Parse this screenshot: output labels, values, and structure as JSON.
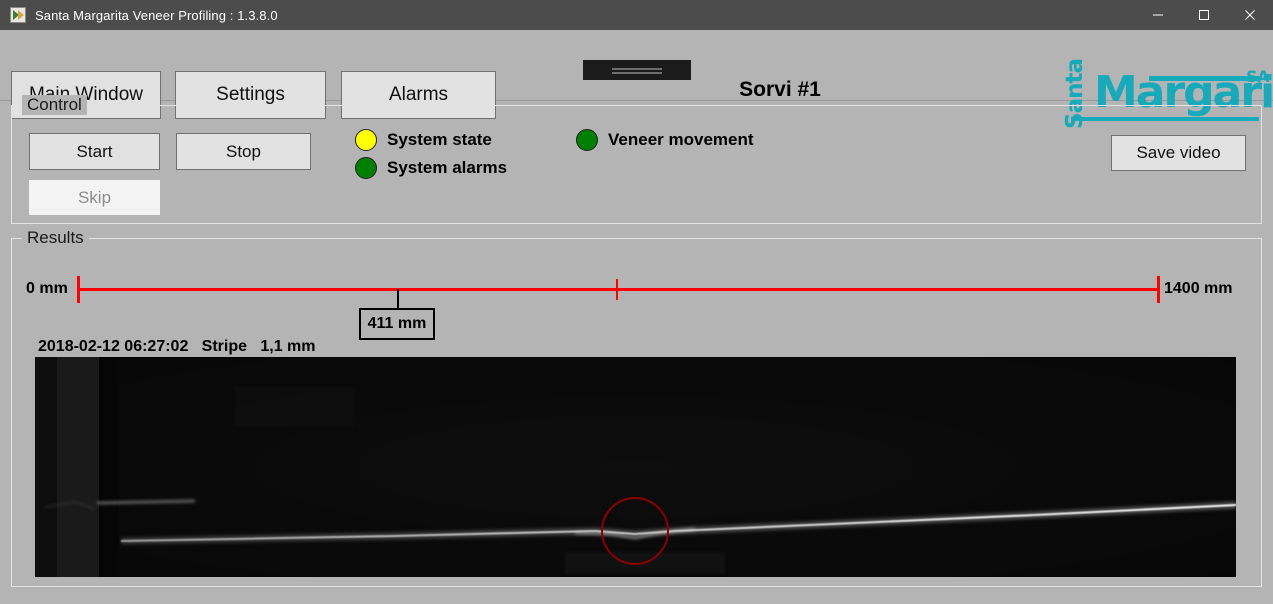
{
  "window": {
    "title": "Santa Margarita Veneer Profiling : 1.3.8.0",
    "icon": "app-icon",
    "minimize": "−",
    "maximize": "□",
    "close": "✕"
  },
  "header": {
    "nav": [
      {
        "label": "Main Window",
        "name": "main-window"
      },
      {
        "label": "Settings",
        "name": "settings"
      },
      {
        "label": "Alarms",
        "name": "alarms"
      }
    ],
    "page_title": "Sorvi #1",
    "logo": {
      "word_top": "Santa",
      "word_main": "Margarita",
      "word_sa": "SA",
      "color": "#16AABA"
    }
  },
  "control": {
    "group_title": "Control",
    "start_label": "Start",
    "stop_label": "Stop",
    "skip_label": "Skip",
    "skip_enabled": false,
    "save_video_label": "Save video",
    "indicators": [
      {
        "label": "System state",
        "color": "#FFFF00",
        "state": "yellow"
      },
      {
        "label": "System alarms",
        "color": "#008000",
        "state": "green"
      },
      {
        "label": "Veneer movement",
        "color": "#008000",
        "state": "green"
      }
    ]
  },
  "results": {
    "group_title": "Results",
    "scale": {
      "start_label": "0 mm",
      "end_label": "1400 mm",
      "start_value": 0,
      "end_value": 1400,
      "line_color": "#FF0000",
      "marker_label": "411 mm",
      "marker_value": 411,
      "tick_value": 700
    },
    "info": {
      "timestamp": "2018-02-12 06:27:02",
      "type": "Stripe",
      "thickness": "1,1 mm",
      "line": "2018-02-12 06:27:02   Stripe   1,1 mm"
    },
    "video": {
      "name": "laser-stripe-video",
      "annotation_color": "#8B0000",
      "annotation_shape": "circle"
    }
  }
}
